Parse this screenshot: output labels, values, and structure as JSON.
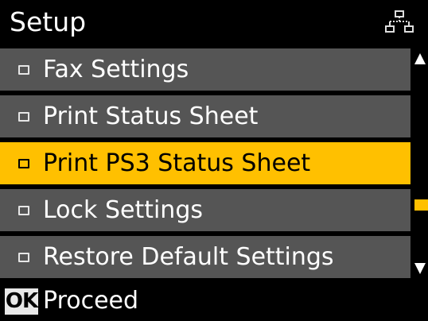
{
  "header": {
    "title": "Setup",
    "icon": "network-icon"
  },
  "menu": {
    "items": [
      {
        "label": "Fax Settings",
        "selected": false
      },
      {
        "label": "Print Status Sheet",
        "selected": false
      },
      {
        "label": "Print PS3 Status Sheet",
        "selected": true
      },
      {
        "label": "Lock Settings",
        "selected": false
      },
      {
        "label": "Restore Default Settings",
        "selected": false
      }
    ]
  },
  "scrollbar": {
    "thumb_color": "#ffc000"
  },
  "footer": {
    "ok_label": "OK",
    "action_label": "Proceed"
  },
  "colors": {
    "accent": "#ffc000",
    "row": "#555555",
    "background": "#000000"
  }
}
